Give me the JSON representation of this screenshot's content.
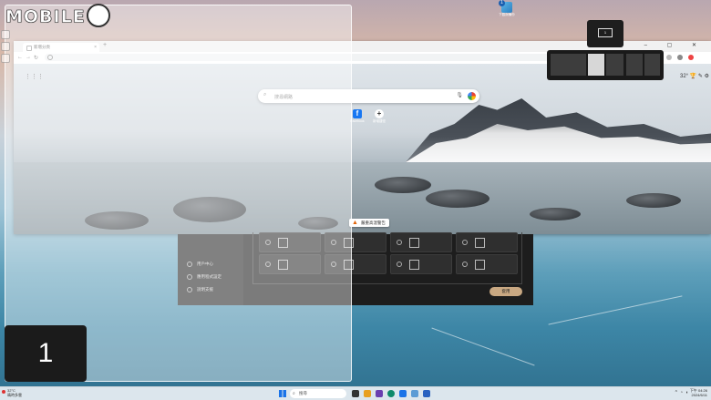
{
  "brand": {
    "text": "MOBILE"
  },
  "desktop": {
    "shortcut_badge": "1",
    "shortcut_label": "下載與備份"
  },
  "browser": {
    "tab_title": "新增分頁",
    "tab_close": "×",
    "new_tab": "+",
    "window_controls": "– ▢ ✕",
    "search_placeholder": "搜尋網路",
    "shortcuts": [
      {
        "icon": "f",
        "label": "Facebook"
      },
      {
        "icon": "+",
        "label": "新增捷徑"
      }
    ],
    "weather_temp": "32°",
    "warning_text": "嚴重高溫警告"
  },
  "settings": {
    "side_items": [
      {
        "label": "用戶中心",
        "icon": "user-icon"
      },
      {
        "label": "應用程式設定",
        "icon": "gear-icon"
      },
      {
        "label": "說明支援",
        "icon": "help-icon"
      }
    ],
    "apply_label": "套用"
  },
  "snap": {
    "zone_number": "1",
    "indicator_number": "1",
    "active_cell_index": 1
  },
  "taskbar": {
    "weather_temp": "32°C",
    "weather_desc": "晴時多雲",
    "search_label": "搜尋",
    "time": "下午 04:26",
    "date": "2024/6/11"
  },
  "colors": {
    "accent_blue": "#1a73e8",
    "apply_button": "#c9a882",
    "warning_orange": "#e0640a"
  }
}
